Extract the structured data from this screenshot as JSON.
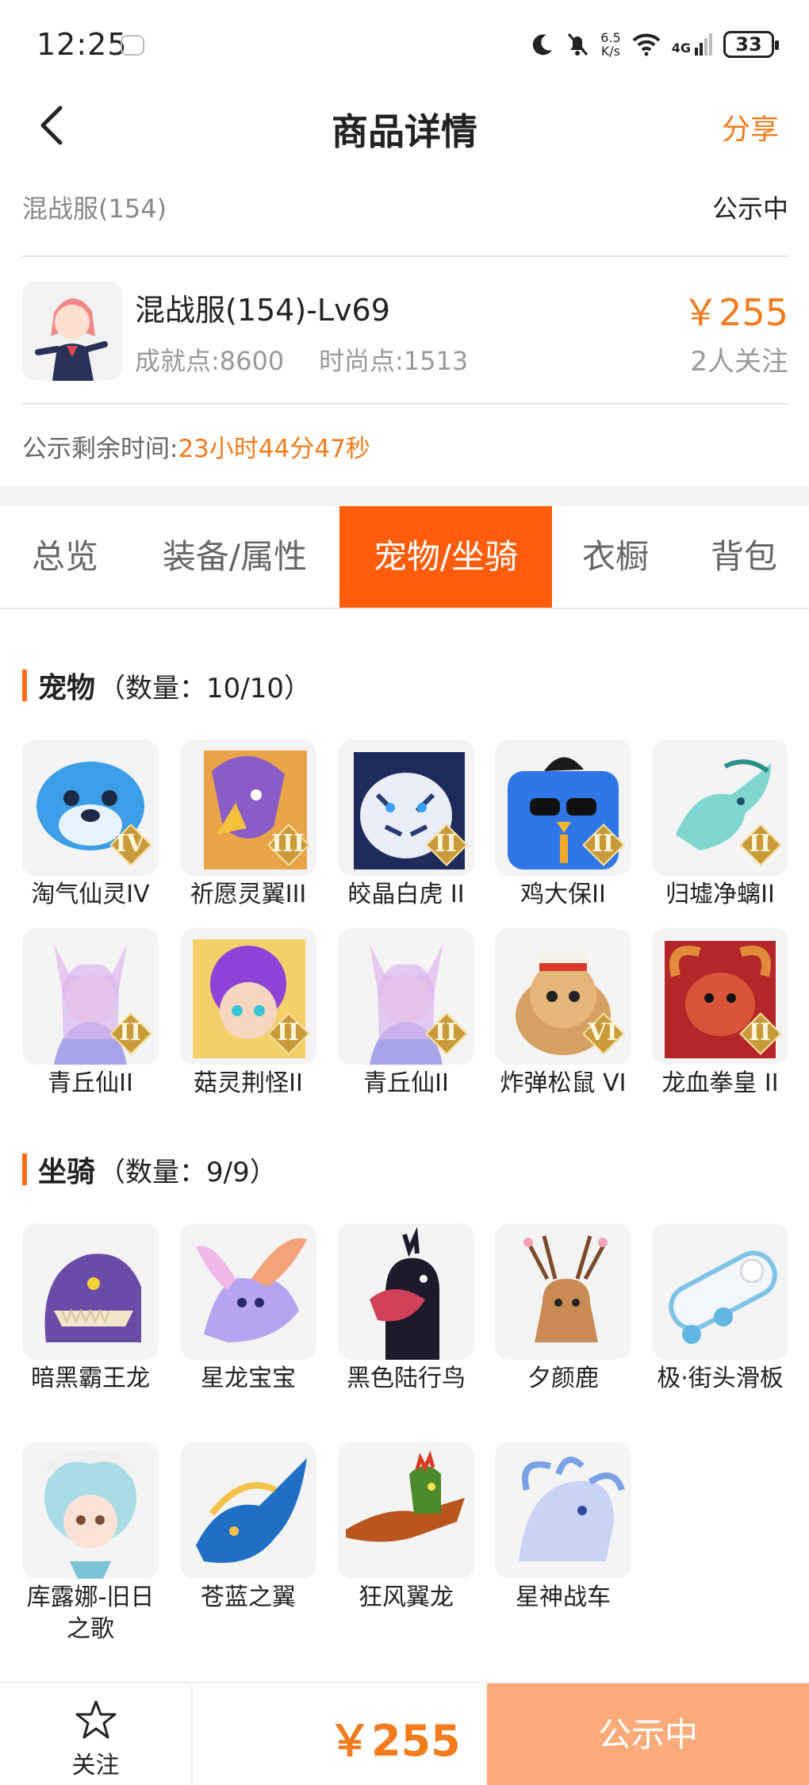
{
  "status_bar": {
    "time": "12:25",
    "net_speed_value": "6.5",
    "net_speed_unit": "K/s",
    "network": "4G",
    "battery": "33"
  },
  "nav": {
    "title": "商品详情",
    "share": "分享"
  },
  "server": {
    "name": "混战服(154)",
    "status": "公示中"
  },
  "character": {
    "title": "混战服(154)-Lv69",
    "achievement": "成就点:8600",
    "fashion": "时尚点:1513",
    "price": "￥255",
    "followers": "2人关注"
  },
  "remain": {
    "label": "公示剩余时间:",
    "value": "23小时44分47秒"
  },
  "tabs": [
    {
      "label": "总览"
    },
    {
      "label": "装备/属性"
    },
    {
      "label": "宠物/坐骑"
    },
    {
      "label": "衣橱"
    },
    {
      "label": "背包"
    }
  ],
  "active_tab": "宠物/坐骑",
  "pets": {
    "title": "宠物",
    "count": "（数量：10/10）",
    "items": [
      {
        "name": "淘气仙灵IV",
        "tier": "IV"
      },
      {
        "name": "祈愿灵翼III",
        "tier": "III"
      },
      {
        "name": "皎晶白虎 II",
        "tier": "II"
      },
      {
        "name": "鸡大保II",
        "tier": "II"
      },
      {
        "name": "归墟净螭II",
        "tier": "II"
      },
      {
        "name": "青丘仙II",
        "tier": "II"
      },
      {
        "name": "菇灵荆怪II",
        "tier": "II"
      },
      {
        "name": "青丘仙II",
        "tier": "II"
      },
      {
        "name": "炸弹松鼠 VI",
        "tier": "VI"
      },
      {
        "name": "龙血拳皇 II",
        "tier": "II"
      }
    ]
  },
  "mounts": {
    "title": "坐骑",
    "count": "（数量：9/9）",
    "items": [
      {
        "name": "暗黑霸王龙"
      },
      {
        "name": "星龙宝宝"
      },
      {
        "name": "黑色陆行鸟"
      },
      {
        "name": "夕颜鹿"
      },
      {
        "name": "极·街头滑板"
      },
      {
        "name": "库露娜-旧日之歌"
      },
      {
        "name": "苍蓝之翼"
      },
      {
        "name": "狂风翼龙"
      },
      {
        "name": "星神战车"
      }
    ]
  },
  "bottom": {
    "follow": "关注",
    "price": "￥255",
    "status": "公示中"
  },
  "colors": {
    "accent": "#ff5d0c",
    "price": "#f07c1e",
    "status_button": "#fbab7a"
  }
}
